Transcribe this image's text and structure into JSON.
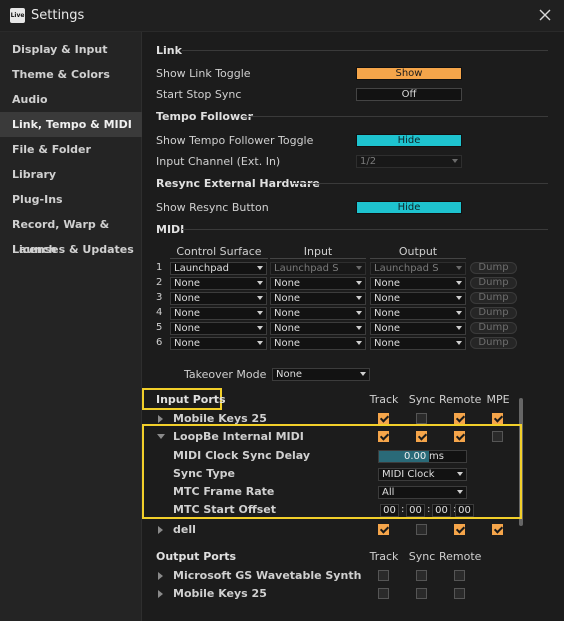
{
  "window": {
    "title": "Settings",
    "app_icon_text": "Live"
  },
  "sidebar": {
    "items": [
      {
        "label": "Display & Input"
      },
      {
        "label": "Theme & Colors"
      },
      {
        "label": "Audio"
      },
      {
        "label": "Link, Tempo & MIDI"
      },
      {
        "label": "File & Folder"
      },
      {
        "label": "Library"
      },
      {
        "label": "Plug-Ins"
      },
      {
        "label": "Record, Warp & Launch"
      },
      {
        "label": "Licenses & Updates"
      }
    ]
  },
  "link": {
    "header": "Link",
    "show_link_toggle_label": "Show Link Toggle",
    "show_link_toggle_value": "Show",
    "start_stop_sync_label": "Start Stop Sync",
    "start_stop_sync_value": "Off"
  },
  "tempo": {
    "header": "Tempo Follower",
    "show_toggle_label": "Show Tempo Follower Toggle",
    "show_toggle_value": "Hide",
    "input_channel_label": "Input Channel (Ext. In)",
    "input_channel_value": "1/2"
  },
  "resync": {
    "header": "Resync External Hardware",
    "show_button_label": "Show Resync Button",
    "show_button_value": "Hide"
  },
  "midi": {
    "header": "MIDI",
    "col_control_surface": "Control Surface",
    "col_input": "Input",
    "col_output": "Output",
    "dump_label": "Dump",
    "rows": [
      {
        "num": "1",
        "surface": "Launchpad",
        "input": "Launchpad S",
        "output": "Launchpad S"
      },
      {
        "num": "2",
        "surface": "None",
        "input": "None",
        "output": "None"
      },
      {
        "num": "3",
        "surface": "None",
        "input": "None",
        "output": "None"
      },
      {
        "num": "4",
        "surface": "None",
        "input": "None",
        "output": "None"
      },
      {
        "num": "5",
        "surface": "None",
        "input": "None",
        "output": "None"
      },
      {
        "num": "6",
        "surface": "None",
        "input": "None",
        "output": "None"
      }
    ],
    "takeover_label": "Takeover Mode",
    "takeover_value": "None"
  },
  "input_ports": {
    "header": "Input Ports",
    "col_track": "Track",
    "col_sync": "Sync",
    "col_remote": "Remote",
    "col_mpe": "MPE",
    "ports": [
      {
        "name": "Mobile Keys 25",
        "track": true,
        "sync": false,
        "remote": true,
        "mpe": true
      },
      {
        "name": "LoopBe Internal MIDI",
        "track": true,
        "sync": true,
        "remote": true,
        "mpe": false
      },
      {
        "name": "dell",
        "track": true,
        "sync": false,
        "remote": true,
        "mpe": true
      }
    ],
    "loopbe": {
      "clock_delay_label": "MIDI Clock Sync Delay",
      "clock_delay_value": "0.00",
      "clock_delay_unit": "ms",
      "sync_type_label": "Sync Type",
      "sync_type_value": "MIDI Clock",
      "mtc_rate_label": "MTC Frame Rate",
      "mtc_rate_value": "All",
      "mtc_offset_label": "MTC Start Offset",
      "mtc_offset": [
        "00",
        "00",
        "00",
        "00"
      ]
    }
  },
  "output_ports": {
    "header": "Output Ports",
    "col_track": "Track",
    "col_sync": "Sync",
    "col_remote": "Remote",
    "ports": [
      {
        "name": "Microsoft GS Wavetable Synth",
        "track": false,
        "sync": false,
        "remote": false
      },
      {
        "name": "Mobile Keys 25",
        "track": false,
        "sync": false,
        "remote": false
      }
    ]
  },
  "colors": {
    "orange": "#f5a54a",
    "cyan": "#1ec3cf",
    "highlight": "#f2cf2a"
  }
}
